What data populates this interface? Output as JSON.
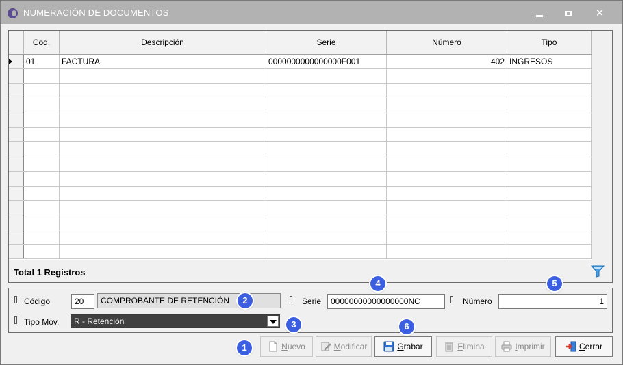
{
  "window": {
    "title": "NUMERACIÓN DE DOCUMENTOS"
  },
  "grid": {
    "columns": [
      "Cod.",
      "Descripción",
      "Serie",
      "Número",
      "Tipo"
    ],
    "rows": [
      {
        "cod": "01",
        "descripcion": "FACTURA",
        "serie": "0000000000000000F001",
        "numero": "402",
        "tipo": "INGRESOS"
      }
    ],
    "total_label": "Total 1 Registros"
  },
  "form": {
    "codigo_label": "Código",
    "codigo_value": "20",
    "codigo_desc": "COMPROBANTE DE RETENCIÓN",
    "serie_label": "Serie",
    "serie_value": "00000000000000000NC",
    "numero_label": "Número",
    "numero_value": "1",
    "tipo_label": "Tipo Mov.",
    "tipo_value": "R - Retención"
  },
  "buttons": {
    "nuevo_first": "N",
    "nuevo_rest": "uevo",
    "modificar_first": "M",
    "modificar_rest": "odificar",
    "grabar_first": "G",
    "grabar_rest": "rabar",
    "elimina_first": "E",
    "elimina_rest": "limina",
    "imprimir_first": "I",
    "imprimir_rest": "mprimir",
    "cerrar_first": "C",
    "cerrar_rest": "errar"
  },
  "badges": [
    "1",
    "2",
    "3",
    "4",
    "5",
    "6"
  ],
  "colors": {
    "titlebar": "#b2b2b2",
    "badge": "#3b5fe0",
    "select_bg": "#404040"
  }
}
